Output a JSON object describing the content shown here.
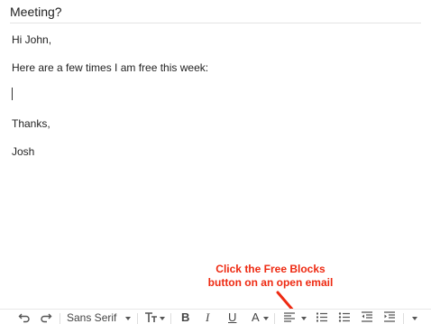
{
  "email": {
    "subject": "Meeting?",
    "greeting": "Hi John,",
    "line1": "Here are a few times I am free this week:",
    "closing": "Thanks,",
    "signature": "Josh"
  },
  "annotation": {
    "line1": "Click the Free Blocks",
    "line2": "button on an open email",
    "color": "#ee2a12"
  },
  "toolbar": {
    "font_name": "Sans Serif",
    "bold_label": "B",
    "italic_label": "I",
    "underline_label": "U",
    "text_color_label": "A",
    "icons": [
      "undo-icon",
      "redo-icon",
      "font-dropdown",
      "text-size-icon",
      "bold-icon",
      "italic-icon",
      "underline-icon",
      "text-color-icon",
      "align-icon",
      "numbered-list-icon",
      "bulleted-list-icon",
      "indent-less-icon",
      "indent-more-icon",
      "more-formatting-icon"
    ]
  }
}
